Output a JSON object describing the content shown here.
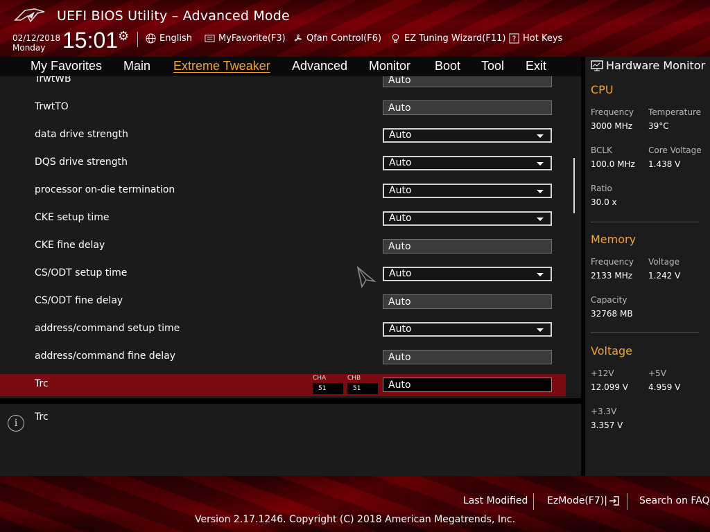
{
  "header": {
    "title": "UEFI BIOS Utility – Advanced Mode",
    "date": "02/12/2018",
    "weekday": "Monday",
    "time": "15:01",
    "toolbar": {
      "language": "English",
      "myfavorite": "MyFavorite(F3)",
      "qfan": "Qfan Control(F6)",
      "ez_tuning": "EZ Tuning Wizard(F11)",
      "hotkeys": "Hot Keys"
    }
  },
  "nav": {
    "tabs": [
      "My Favorites",
      "Main",
      "Extreme Tweaker",
      "Advanced",
      "Monitor",
      "Boot",
      "Tool",
      "Exit"
    ],
    "active": "Extreme Tweaker"
  },
  "settings": [
    {
      "label": "TrwtWB",
      "value": "Auto",
      "type": "readonly"
    },
    {
      "label": "TrwtTO",
      "value": "Auto",
      "type": "readonly"
    },
    {
      "label": "data drive strength",
      "value": "Auto",
      "type": "dropdown"
    },
    {
      "label": "DQS drive strength",
      "value": "Auto",
      "type": "dropdown"
    },
    {
      "label": "processor on-die termination",
      "value": "Auto",
      "type": "dropdown"
    },
    {
      "label": "CKE setup time",
      "value": "Auto",
      "type": "dropdown"
    },
    {
      "label": "CKE fine delay",
      "value": "Auto",
      "type": "readonly"
    },
    {
      "label": "CS/ODT setup time",
      "value": "Auto",
      "type": "dropdown"
    },
    {
      "label": "CS/ODT fine delay",
      "value": "Auto",
      "type": "readonly"
    },
    {
      "label": "address/command setup time",
      "value": "Auto",
      "type": "dropdown"
    },
    {
      "label": "address/command fine delay",
      "value": "Auto",
      "type": "readonly"
    },
    {
      "label": "Trc",
      "value": "Auto",
      "type": "selected"
    }
  ],
  "trc_channels": {
    "cha_label": "CHA",
    "cha_value": "51",
    "chb_label": "CHB",
    "chb_value": "51"
  },
  "help": {
    "text": "Trc"
  },
  "hardware_monitor": {
    "title": "Hardware Monitor",
    "cpu": {
      "heading": "CPU",
      "frequency_label": "Frequency",
      "frequency": "3000 MHz",
      "temperature_label": "Temperature",
      "temperature": "39°C",
      "bclk_label": "BCLK",
      "bclk": "100.0 MHz",
      "core_voltage_label": "Core Voltage",
      "core_voltage": "1.438 V",
      "ratio_label": "Ratio",
      "ratio": "30.0 x"
    },
    "memory": {
      "heading": "Memory",
      "frequency_label": "Frequency",
      "frequency": "2133 MHz",
      "voltage_label": "Voltage",
      "voltage": "1.242 V",
      "capacity_label": "Capacity",
      "capacity": "32768 MB"
    },
    "voltage": {
      "heading": "Voltage",
      "v12_label": "+12V",
      "v12": "12.099 V",
      "v5_label": "+5V",
      "v5": "4.959 V",
      "v33_label": "+3.3V",
      "v33": "3.357 V"
    }
  },
  "footer": {
    "last_modified": "Last Modified",
    "ezmode": "EzMode(F7)|",
    "search_faq": "Search on FAQ",
    "version": "Version 2.17.1246. Copyright (C) 2018 American Megatrends, Inc."
  },
  "colors": {
    "accent": "#f5a623",
    "selected_row": "#7a0a0f",
    "brand_red": "#5a0007"
  }
}
